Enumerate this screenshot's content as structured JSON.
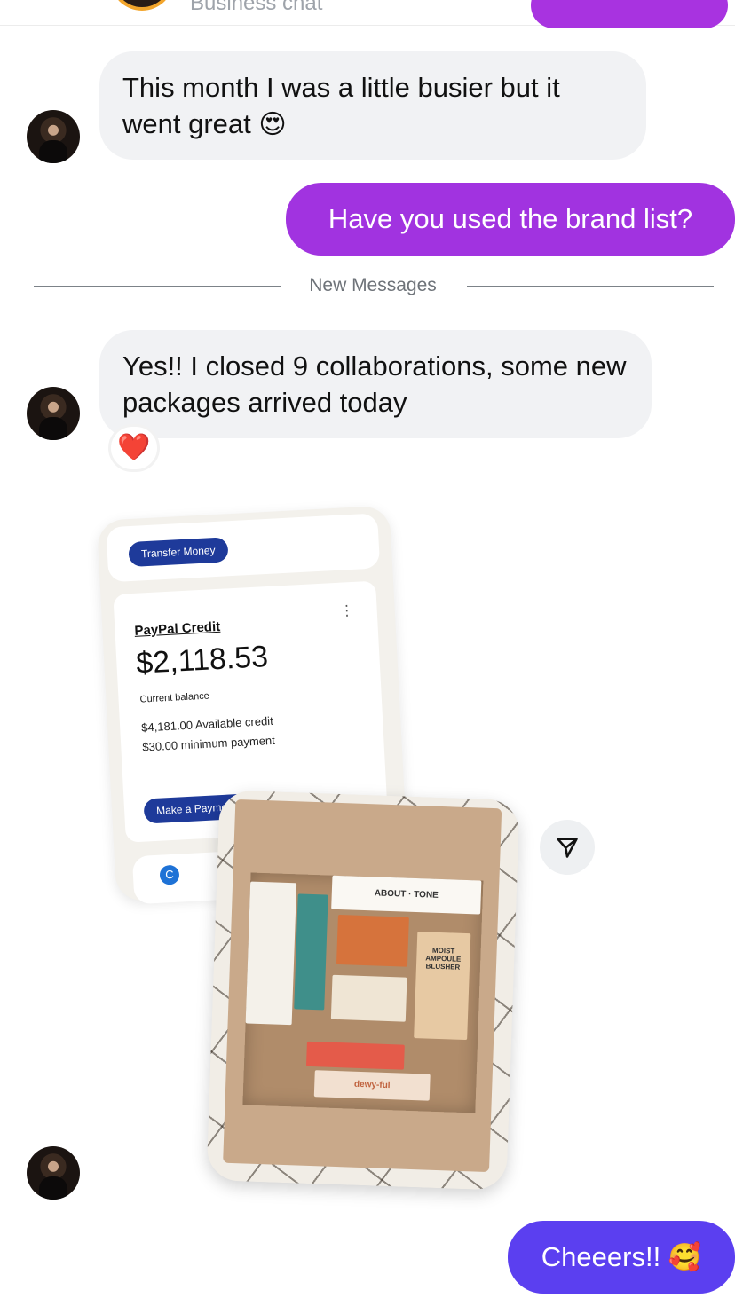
{
  "header": {
    "subtitle": "Business chat"
  },
  "messages": [
    {
      "id": "m1",
      "direction": "incoming",
      "text": "This month I was a little busier but it went great",
      "emoji": "😍"
    },
    {
      "id": "m2",
      "direction": "outgoing",
      "text": "Have you used the brand list?"
    },
    {
      "id": "m3",
      "direction": "incoming",
      "text": "Yes!! I closed 9 collaborations, some new packages arrived today",
      "reaction": "❤️"
    },
    {
      "id": "m5",
      "direction": "outgoing",
      "text": "Cheeers!!",
      "emoji": "🥰"
    }
  ],
  "divider": {
    "label": "New Messages"
  },
  "shared_post": {
    "paypal": {
      "transfer_label": "Transfer Money",
      "card_title": "PayPal Credit",
      "balance": "$2,118.53",
      "balance_caption": "Current balance",
      "available_credit": "$4,181.00 Available credit",
      "minimum_payment": "$30.00 minimum payment",
      "pay_button": "Make a Payment",
      "menu_glyph": "⋮"
    },
    "box_labels": {
      "about": "ABOUT",
      "tone": "TONE",
      "brand_dewy": "dewy-ful",
      "blusher": "MOIST AMPOULE BLUSHER"
    }
  },
  "icons": {
    "share": "paper-plane-icon",
    "heart": "heart-icon"
  },
  "colors": {
    "outgoing_bubble": "#a133e0",
    "last_outgoing_bubble": "#5b3ff0",
    "incoming_bubble": "#f1f2f4",
    "paypal_blue": "#1e3a9a"
  }
}
